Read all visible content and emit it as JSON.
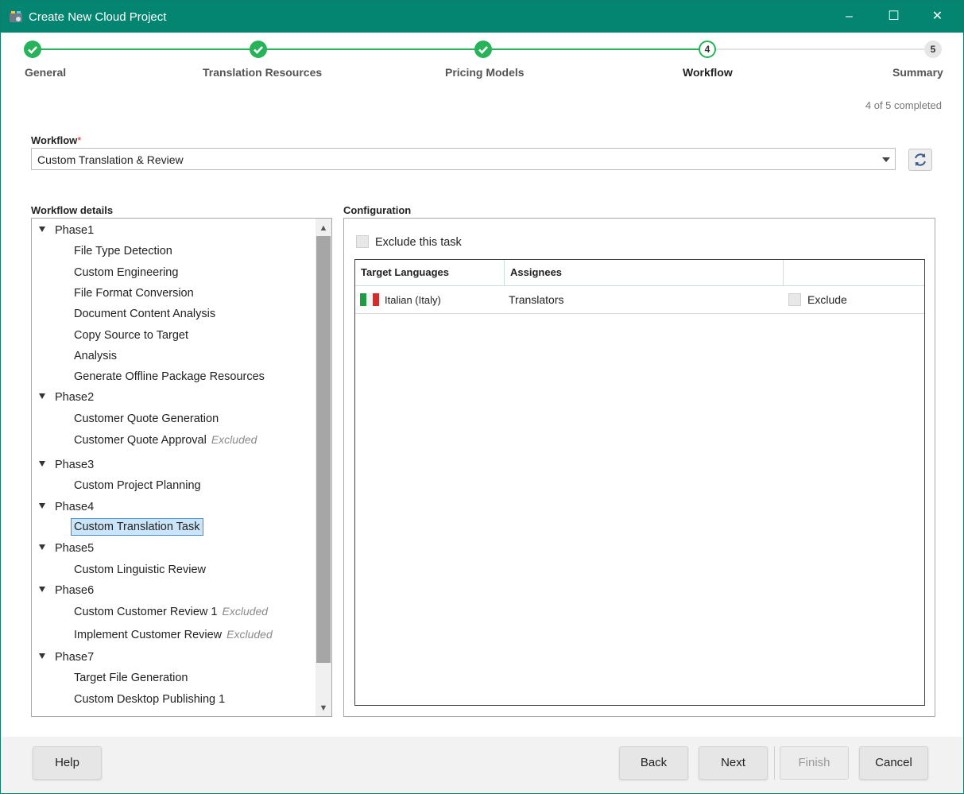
{
  "window": {
    "title": "Create New Cloud Project",
    "minimize": "–",
    "maximize": "☐",
    "close": "✕"
  },
  "stepper": {
    "steps": [
      {
        "label": "General",
        "state": "done"
      },
      {
        "label": "Translation Resources",
        "state": "done"
      },
      {
        "label": "Pricing Models",
        "state": "done"
      },
      {
        "label": "Workflow",
        "state": "current",
        "number": "4"
      },
      {
        "label": "Summary",
        "state": "todo",
        "number": "5"
      }
    ],
    "progress": "4 of 5 completed",
    "accent_color": "#27b35a"
  },
  "workflow": {
    "label": "Workflow",
    "required_mark": "*",
    "selected": "Custom Translation & Review"
  },
  "details": {
    "label": "Workflow details",
    "phases": [
      {
        "name": "Phase1",
        "tasks": [
          {
            "name": "File Type Detection"
          },
          {
            "name": "Custom Engineering"
          },
          {
            "name": "File Format Conversion"
          },
          {
            "name": "Document Content Analysis"
          },
          {
            "name": "Copy Source to Target"
          },
          {
            "name": "Analysis"
          },
          {
            "name": "Generate Offline Package Resources"
          }
        ]
      },
      {
        "name": "Phase2",
        "tasks": [
          {
            "name": "Customer Quote Generation"
          },
          {
            "name": "Customer Quote Approval",
            "status": "Excluded"
          }
        ]
      },
      {
        "name": "Phase3",
        "tasks": [
          {
            "name": "Custom Project Planning"
          }
        ]
      },
      {
        "name": "Phase4",
        "tasks": [
          {
            "name": "Custom Translation Task",
            "selected": true
          }
        ]
      },
      {
        "name": "Phase5",
        "tasks": [
          {
            "name": "Custom Linguistic Review"
          }
        ]
      },
      {
        "name": "Phase6",
        "tasks": [
          {
            "name": "Custom Customer Review 1",
            "status": "Excluded"
          },
          {
            "name": "Implement Customer Review",
            "status": "Excluded"
          }
        ]
      },
      {
        "name": "Phase7",
        "tasks": [
          {
            "name": "Target File Generation"
          },
          {
            "name": "Custom Desktop Publishing 1"
          }
        ]
      }
    ]
  },
  "configuration": {
    "label": "Configuration",
    "exclude_task_label": "Exclude this task",
    "columns": [
      "Target Languages",
      "Assignees",
      ""
    ],
    "rows": [
      {
        "language": "Italian (Italy)",
        "flag": "italy-flag-icon",
        "assignees": "Translators",
        "exclude_label": "Exclude"
      }
    ]
  },
  "footer": {
    "help": "Help",
    "back": "Back",
    "next": "Next",
    "finish": "Finish",
    "cancel": "Cancel"
  }
}
